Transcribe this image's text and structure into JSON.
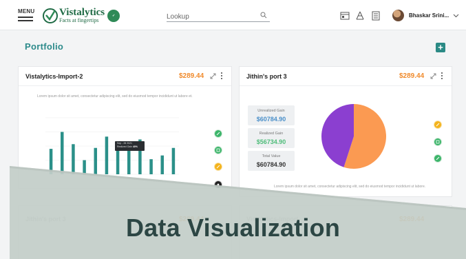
{
  "header": {
    "menu_label": "MENU",
    "logo_name": "Vistalytics",
    "logo_tagline": "Facts at fingertips",
    "search_placeholder": "Lookup",
    "user_name": "Bhaskar Srini..."
  },
  "page": {
    "title": "Portfolio",
    "add_label": "+"
  },
  "cards": [
    {
      "title": "Vistalytics-Import-2",
      "value": "$289.44",
      "description": "Lorem ipsum dolor sit amet, consectetur adipiscing elit, sed do eiusmod tempor incididunt ut labore et.",
      "tooltip": {
        "date": "Sep - 28 2021",
        "label": "Realized Gain",
        "percent": "40%"
      }
    },
    {
      "title": "Jithin's port 3",
      "value": "$289.44",
      "stats": [
        {
          "label": "Unrealized Gain",
          "value": "$60784.90",
          "color": "#4a8fc9"
        },
        {
          "label": "Realized Gain",
          "value": "$56734.90",
          "color": "#4fbd7a"
        },
        {
          "label": "Total Value",
          "value": "$60784.90",
          "color": "#333333"
        }
      ],
      "description": "Lorem ipsum dolor sit amet, consectetur adipiscing elit, sed do eiusmod tempor incididunt ut labore."
    },
    {
      "title": "Jithin's port 3",
      "value": "$289.44"
    },
    {
      "title": "Vistalytics-Import",
      "value": "$289.44"
    }
  ],
  "overlay": {
    "title": "Data Visualization"
  },
  "chart_data": [
    {
      "type": "bar",
      "categories": [
        "",
        "",
        "",
        "",
        "",
        "",
        "",
        "",
        "",
        "",
        "",
        ""
      ],
      "values": [
        27,
        45,
        32,
        15,
        28,
        40,
        26,
        30,
        37,
        16,
        20,
        28
      ],
      "ylim": [
        0,
        60
      ],
      "color": "#2b9089",
      "grid": true
    },
    {
      "type": "pie",
      "values": [
        55,
        45
      ],
      "colors": [
        "#fb9a52",
        "#8b3fd0"
      ]
    }
  ],
  "icons": [
    "search-icon",
    "folder-icon",
    "network-icon",
    "document-icon",
    "chevron-down-icon",
    "expand-icon",
    "more-icon"
  ],
  "colors": {
    "accent": "#2c8a8a",
    "value_orange": "#f08a2b",
    "overlay": "#c3cdc8"
  }
}
